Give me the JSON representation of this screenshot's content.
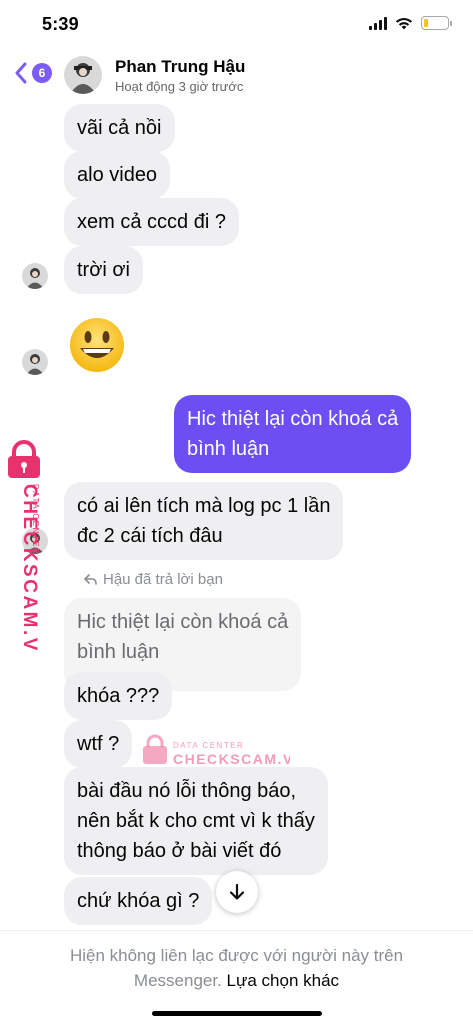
{
  "status_bar": {
    "time": "5:39",
    "icons": [
      "signal-icon",
      "wifi-icon",
      "battery-icon"
    ],
    "battery_level": 0.2
  },
  "header": {
    "unread_count": "6",
    "contact_name": "Phan Trung Hậu",
    "contact_status": "Hoạt động 3 giờ trước"
  },
  "messages": [
    {
      "direction": "in",
      "text": "vãi cả nồi"
    },
    {
      "direction": "in",
      "text": "alo video"
    },
    {
      "direction": "in",
      "text": "xem cả cccd đi ?"
    },
    {
      "direction": "in",
      "text": "trời ơi"
    },
    {
      "direction": "in",
      "emoji": "grinning-face"
    },
    {
      "direction": "out",
      "lines": [
        "Hic thiệt lại còn khoá cả",
        "bình luận"
      ]
    },
    {
      "direction": "in",
      "lines": [
        "có ai lên tích mà log pc 1 lần",
        "đc 2 cái tích đâu"
      ]
    },
    {
      "direction": "in",
      "reply_label": "Hậu đã trả lời bạn",
      "quoted_lines": [
        "Hic thiệt lại còn khoá cả",
        "bình luận"
      ]
    },
    {
      "direction": "in",
      "text": "khóa ???"
    },
    {
      "direction": "in",
      "text": "wtf ?"
    },
    {
      "direction": "in",
      "lines": [
        "bài đầu nó lỗi thông báo,",
        "nên bắt k cho cmt vì k thấy",
        "thông báo ở bài viết đó"
      ]
    },
    {
      "direction": "in",
      "text": "chứ khóa gì ?"
    }
  ],
  "watermark": {
    "side_brand": "CHECKSCAM.VN",
    "side_tag": "DATA CENTER",
    "center_tag": "DATA CENTER",
    "center_brand": "CHECKSCAM.VN",
    "color": "#e8326e"
  },
  "footer": {
    "notice_line1": "Hiện không liên lạc được với người này trên",
    "notice_line2": "Messenger.",
    "link": "Lựa chọn khác"
  },
  "colors": {
    "accent": "#7b5cf5",
    "outgoing_bubble": "#6b4ff2",
    "incoming_bubble": "#efeff1"
  }
}
